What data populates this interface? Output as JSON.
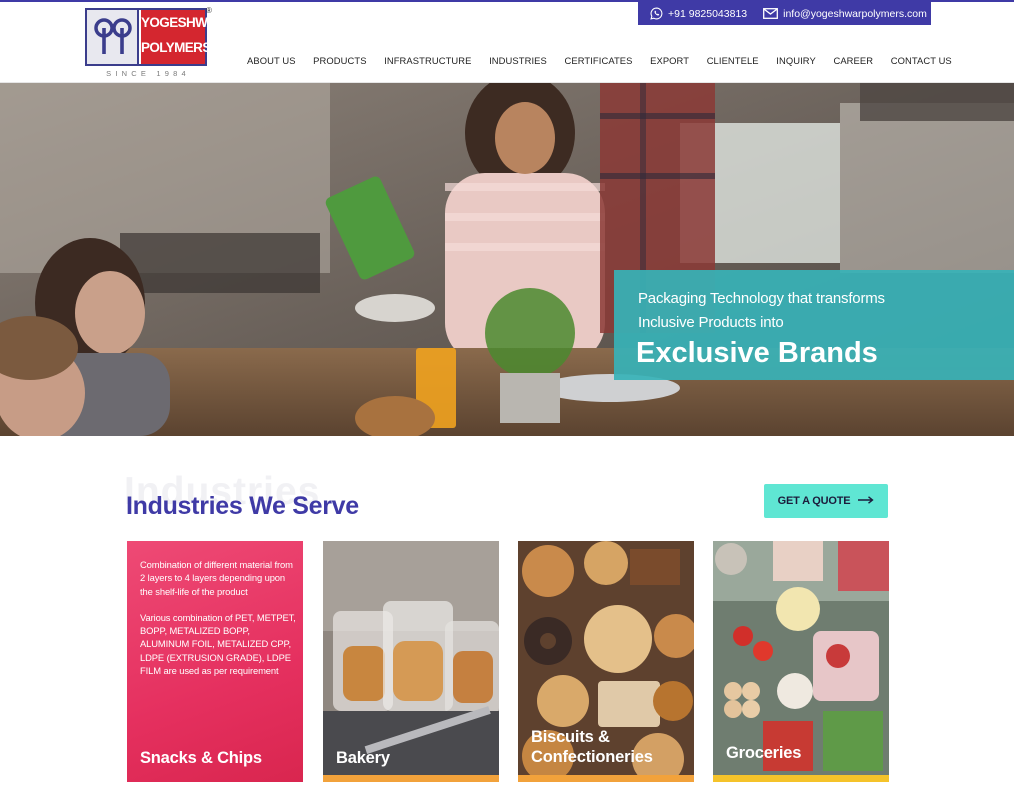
{
  "brand": {
    "name_line1": "YOGESHWAR",
    "name_line2": "POLYMERS",
    "registered": "®",
    "since": "SINCE 1984"
  },
  "contact": {
    "phone": "+91 9825043813",
    "email": "info@yogeshwarpolymers.com",
    "phone_icon": "whatsapp-icon",
    "email_icon": "mail-icon"
  },
  "nav": {
    "items": [
      {
        "label": "ABOUT US"
      },
      {
        "label": "PRODUCTS"
      },
      {
        "label": "INFRASTRUCTURE"
      },
      {
        "label": "INDUSTRIES"
      },
      {
        "label": "CERTIFICATES"
      },
      {
        "label": "EXPORT"
      },
      {
        "label": "CLIENTELE"
      },
      {
        "label": "INQUIRY"
      },
      {
        "label": "CAREER"
      },
      {
        "label": "CONTACT US"
      }
    ]
  },
  "hero": {
    "line1": "Packaging Technology that transforms",
    "line2": "Inclusive Products into",
    "headline": "Exclusive Brands"
  },
  "industries": {
    "ghost_text": "Industries",
    "title": "Industries We Serve",
    "quote_button": "GET A QUOTE",
    "cards": [
      {
        "label": "Snacks & Chips",
        "desc1": "Combination of different material from 2 layers to 4 layers depending upon the shelf-life of the product",
        "desc2": "Various combination of PET, METPET, BOPP, METALIZED BOPP, ALUMINUM FOIL, METALIZED CPP, LDPE (EXTRUSION GRADE), LDPE FILM are used as per requirement"
      },
      {
        "label": "Bakery"
      },
      {
        "label_line1": "Biscuits &",
        "label_line2": "Confectioneries"
      },
      {
        "label": "Groceries"
      }
    ]
  },
  "colors": {
    "brand_blue": "#3f3aa6",
    "brand_red": "#d4262f",
    "teal_overlay": "#37b2b7",
    "quote_button": "#5fe6d3",
    "snacks_card": "#e5305f",
    "card_band": "#f2a23b"
  }
}
